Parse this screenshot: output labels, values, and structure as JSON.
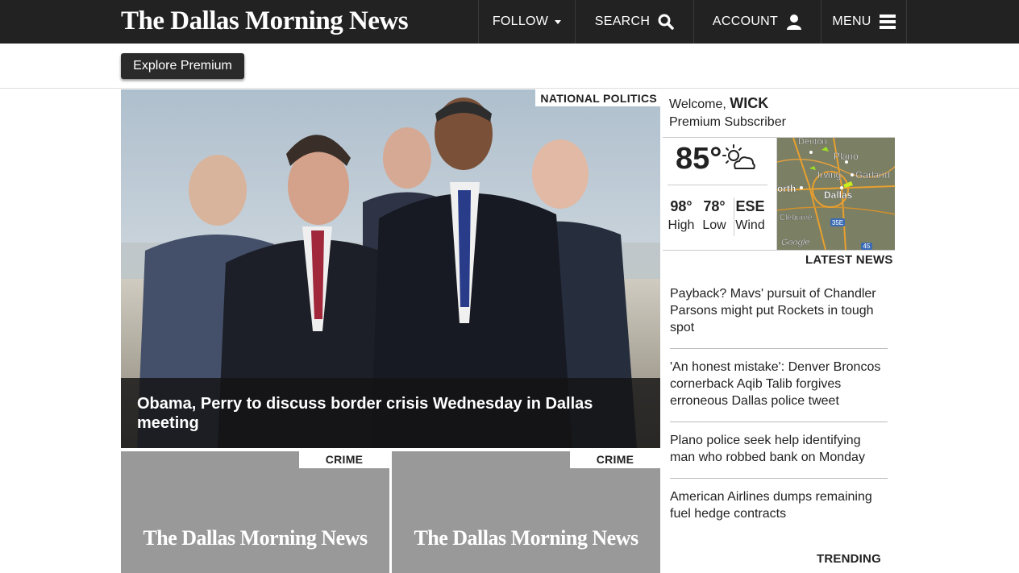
{
  "brand": {
    "logo_text": "The Dallas Morning News"
  },
  "nav": {
    "follow_label": "FOLLOW",
    "search_label": "SEARCH",
    "account_label": "ACCOUNT",
    "menu_label": "MENU"
  },
  "premium": {
    "explore_label": "Explore Premium"
  },
  "hero": {
    "section": "NATIONAL POLITICS",
    "headline": "Obama, Perry to discuss border crisis Wednesday in Dallas meeting"
  },
  "tiles": [
    {
      "section": "CRIME",
      "logo_text": "The Dallas Morning News"
    },
    {
      "section": "CRIME",
      "logo_text": "The Dallas Morning News"
    }
  ],
  "user": {
    "welcome_prefix": "Welcome,",
    "name": "WICK",
    "status": "Premium Subscriber"
  },
  "weather": {
    "temp": "85°",
    "icon": "partly-sunny-icon",
    "high_value": "98°",
    "high_label": "High",
    "low_value": "78°",
    "low_label": "Low",
    "wind_value": "ESE",
    "wind_label": "Wind",
    "map_labels": {
      "denton": "Denton",
      "plano": "Plano",
      "irving": "Irving",
      "garland": "Garland",
      "fortworth": "orth",
      "dallas": "Dallas",
      "cleburne": "Cleburne",
      "google": "Google",
      "hwy35e": "35E",
      "hwy45": "45"
    }
  },
  "latest_news": {
    "title": "LATEST NEWS",
    "items": [
      "Payback? Mavs' pursuit of Chandler Parsons might put Rockets in tough spot",
      "'An honest mistake': Denver Broncos cornerback Aqib Talib forgives erroneous Dallas police tweet",
      "Plano police seek help identifying man who robbed bank on Monday",
      "American Airlines dumps remaining fuel hedge contracts"
    ]
  },
  "trending": {
    "title": "TRENDING"
  },
  "colors": {
    "topbar": "#222222",
    "tile_gray": "#999999",
    "caption_bg": "#141414"
  }
}
